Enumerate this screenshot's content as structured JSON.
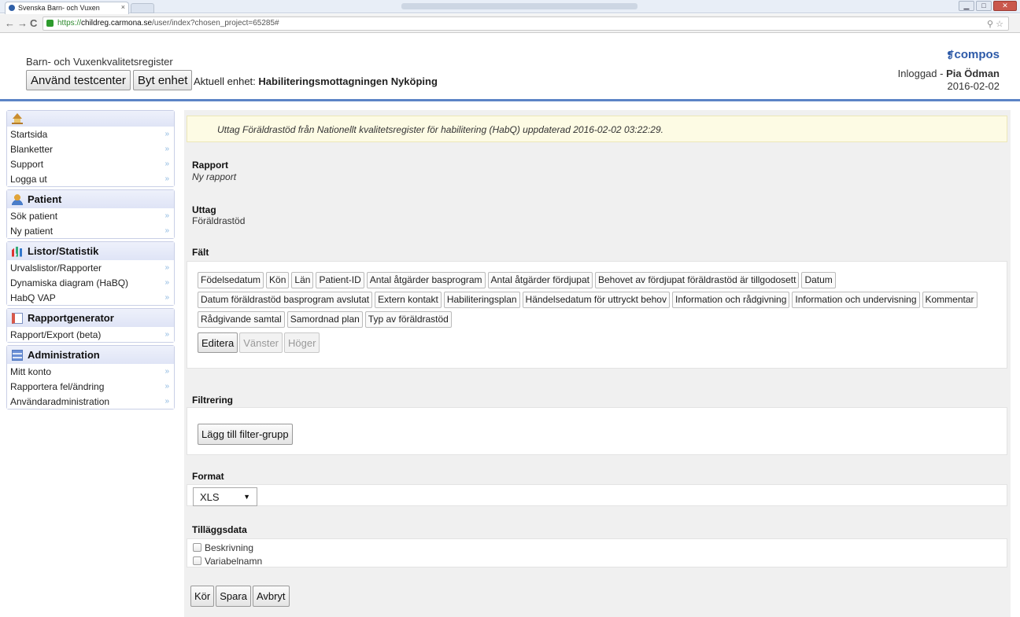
{
  "browser": {
    "tab_title": "Svenska Barn- och Vuxen",
    "tab_close": "×",
    "url_secure": "https://",
    "url_host": "childreg.carmona.se",
    "url_path": "/user/index?chosen_project=65285#",
    "nav_back": "←",
    "nav_forward": "→",
    "nav_reload": "C",
    "tools": "⚲ ☆",
    "win_min": "▁",
    "win_max": "□",
    "win_close": "✕"
  },
  "header": {
    "app_name": "Barn- och Vuxenkvalitetsregister",
    "testcenter_button": "Använd testcenter",
    "change_unit_button": "Byt enhet",
    "current_unit_label": "Aktuell enhet:",
    "current_unit_value": "Habiliteringsmottagningen Nyköping",
    "brand": "compos",
    "logged_in_label": "Inloggad -",
    "user_name": "Pia Ödman",
    "date": "2016-02-02"
  },
  "sidebar": {
    "home_items": [
      {
        "label": "Startsida"
      },
      {
        "label": "Blanketter"
      },
      {
        "label": "Support"
      },
      {
        "label": "Logga ut"
      }
    ],
    "patient": {
      "title": "Patient",
      "items": [
        "Sök patient",
        "Ny patient"
      ]
    },
    "stats": {
      "title": "Listor/Statistik",
      "items": [
        "Urvalslistor/Rapporter",
        "Dynamiska diagram (HaBQ)",
        "HabQ VAP"
      ]
    },
    "report": {
      "title": "Rapportgenerator",
      "items": [
        "Rapport/Export (beta)"
      ]
    },
    "admin": {
      "title": "Administration",
      "items": [
        "Mitt konto",
        "Rapportera fel/ändring",
        "Användaradministration"
      ]
    },
    "arrow": "»"
  },
  "main": {
    "notice": "Uttag Föräldrastöd från Nationellt kvalitetsregister för habilitering (HabQ) uppdaterad 2016-02-02 03:22:29.",
    "report_label": "Rapport",
    "report_value": "Ny rapport",
    "withdrawal_label": "Uttag",
    "withdrawal_value": "Föräldrastöd",
    "fields_label": "Fält",
    "fields": [
      "Födelsedatum",
      "Kön",
      "Län",
      "Patient-ID",
      "Antal åtgärder basprogram",
      "Antal åtgärder fördjupat",
      "Behovet av fördjupat föräldrastöd är tillgodosett",
      "Datum",
      "Datum föräldrastöd basprogram avslutat",
      "Extern kontakt",
      "Habiliteringsplan",
      "Händelsedatum för uttryckt behov",
      "Information och rådgivning",
      "Information och undervisning",
      "Kommentar",
      "Rådgivande samtal",
      "Samordnad plan",
      "Typ av föräldrastöd"
    ],
    "edit_button": "Editera",
    "left_button": "Vänster",
    "right_button": "Höger",
    "filter_label": "Filtrering",
    "add_filter_button": "Lägg till filter-grupp",
    "format_label": "Format",
    "format_value": "XLS",
    "format_arrow": "▼",
    "extra_label": "Tilläggsdata",
    "extra_options": [
      "Beskrivning",
      "Variabelnamn"
    ],
    "run_button": "Kör",
    "save_button": "Spara",
    "cancel_button": "Avbryt"
  }
}
